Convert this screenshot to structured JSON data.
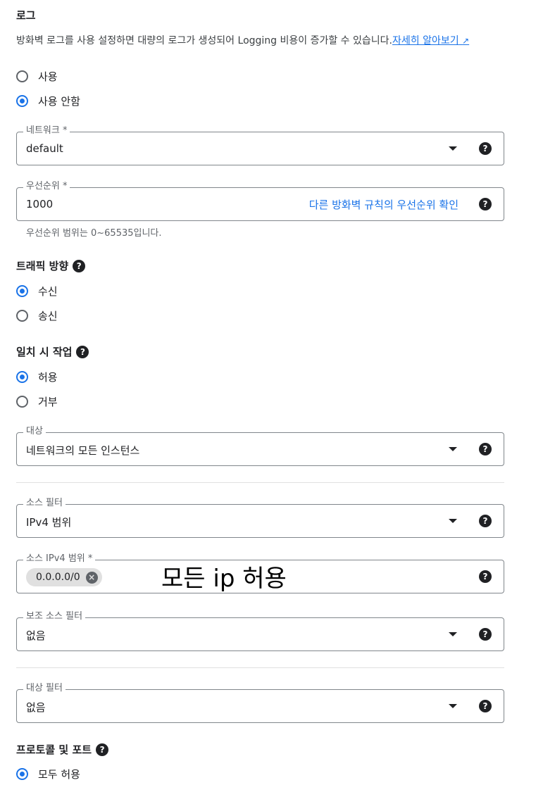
{
  "logs": {
    "title": "로그",
    "description": "방화벽 로그를 사용 설정하면 대량의 로그가 생성되어 Logging 비용이 증가할 수 있습니다.",
    "learn_more": "자세히 알아보기",
    "options": [
      "사용",
      "사용 안함"
    ],
    "selected": "사용 안함"
  },
  "network": {
    "label": "네트워크 *",
    "value": "default"
  },
  "priority": {
    "label": "우선순위 *",
    "value": "1000",
    "link": "다른 방화벽 규칙의 우선순위 확인",
    "hint": "우선순위 범위는 0~65535입니다."
  },
  "direction": {
    "title": "트래픽 방향",
    "options": [
      "수신",
      "송신"
    ],
    "selected": "수신"
  },
  "action": {
    "title": "일치 시 작업",
    "options": [
      "허용",
      "거부"
    ],
    "selected": "허용"
  },
  "target": {
    "label": "대상",
    "value": "네트워크의 모든 인스턴스"
  },
  "source_filter": {
    "label": "소스 필터",
    "value": "IPv4 범위"
  },
  "source_ipv4": {
    "label": "소스 IPv4 범위 *",
    "chip": "0.0.0.0/0",
    "annotation": "모든 ip 허용"
  },
  "secondary_source_filter": {
    "label": "보조 소스 필터",
    "value": "없음"
  },
  "target_filter": {
    "label": "대상 필터",
    "value": "없음"
  },
  "protocols": {
    "title": "프로토콜 및 포트",
    "option": "모두 허용",
    "selected": "모두 허용"
  },
  "icons": {
    "help": "help-circle-icon",
    "dropdown": "caret-down-icon",
    "external": "external-link-icon",
    "chip_remove": "cancel-icon"
  },
  "colors": {
    "accent": "#1a73e8",
    "text": "#202124",
    "border": "#80868b"
  }
}
